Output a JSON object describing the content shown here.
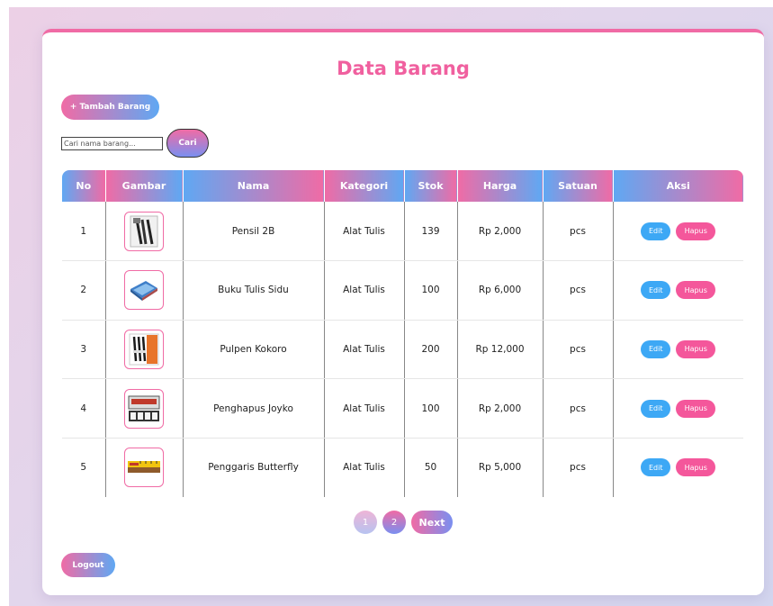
{
  "header": {
    "title": "Data Barang"
  },
  "toolbar": {
    "add_label": "+ Tambah Barang"
  },
  "search": {
    "placeholder": "Cari nama barang...",
    "value": "",
    "button_label": "Cari"
  },
  "table": {
    "columns": [
      "No",
      "Gambar",
      "Nama",
      "Kategori",
      "Stok",
      "Harga",
      "Satuan",
      "Aksi"
    ],
    "rows": [
      {
        "no": "1",
        "image_icon": "pencil-pack-icon",
        "nama": "Pensil 2B",
        "kategori": "Alat Tulis",
        "stok": "139",
        "harga": "Rp 2,000",
        "satuan": "pcs"
      },
      {
        "no": "2",
        "image_icon": "notebook-icon",
        "nama": "Buku Tulis Sidu",
        "kategori": "Alat Tulis",
        "stok": "100",
        "harga": "Rp 6,000",
        "satuan": "pcs"
      },
      {
        "no": "3",
        "image_icon": "pen-pack-icon",
        "nama": "Pulpen Kokoro",
        "kategori": "Alat Tulis",
        "stok": "200",
        "harga": "Rp 12,000",
        "satuan": "pcs"
      },
      {
        "no": "4",
        "image_icon": "eraser-box-icon",
        "nama": "Penghapus Joyko",
        "kategori": "Alat Tulis",
        "stok": "100",
        "harga": "Rp 2,000",
        "satuan": "pcs"
      },
      {
        "no": "5",
        "image_icon": "ruler-icon",
        "nama": "Penggaris Butterfly",
        "kategori": "Alat Tulis",
        "stok": "50",
        "harga": "Rp 5,000",
        "satuan": "pcs"
      }
    ],
    "actions": {
      "edit_label": "Edit",
      "delete_label": "Hapus"
    }
  },
  "pagination": {
    "pages": [
      "1",
      "2"
    ],
    "current": "1",
    "next_label": "Next"
  },
  "footer": {
    "logout_label": "Logout"
  },
  "colors": {
    "accent_pink": "#f06ba5",
    "accent_blue": "#5fa8f3",
    "edit_blue": "#3da8f5",
    "delete_pink": "#f4579b"
  }
}
